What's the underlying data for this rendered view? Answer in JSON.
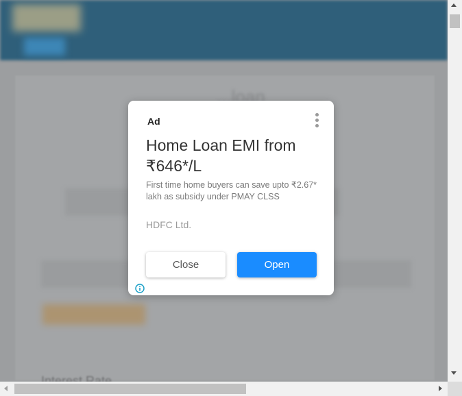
{
  "background": {
    "heading_text": "...loan",
    "bottom_label": "Interest Rate"
  },
  "ad": {
    "label": "Ad",
    "title": "Home Loan EMI from ₹646*/L",
    "description": "First time home buyers can save upto ₹2.67* lakh as subsidy under PMAY CLSS",
    "advertiser": "HDFC Ltd.",
    "close_label": "Close",
    "open_label": "Open",
    "menu_icon": "kebab-menu-icon",
    "info_icon": "info-icon"
  },
  "colors": {
    "open_button": "#1a8cff",
    "info_icon": "#1aa0c8"
  }
}
